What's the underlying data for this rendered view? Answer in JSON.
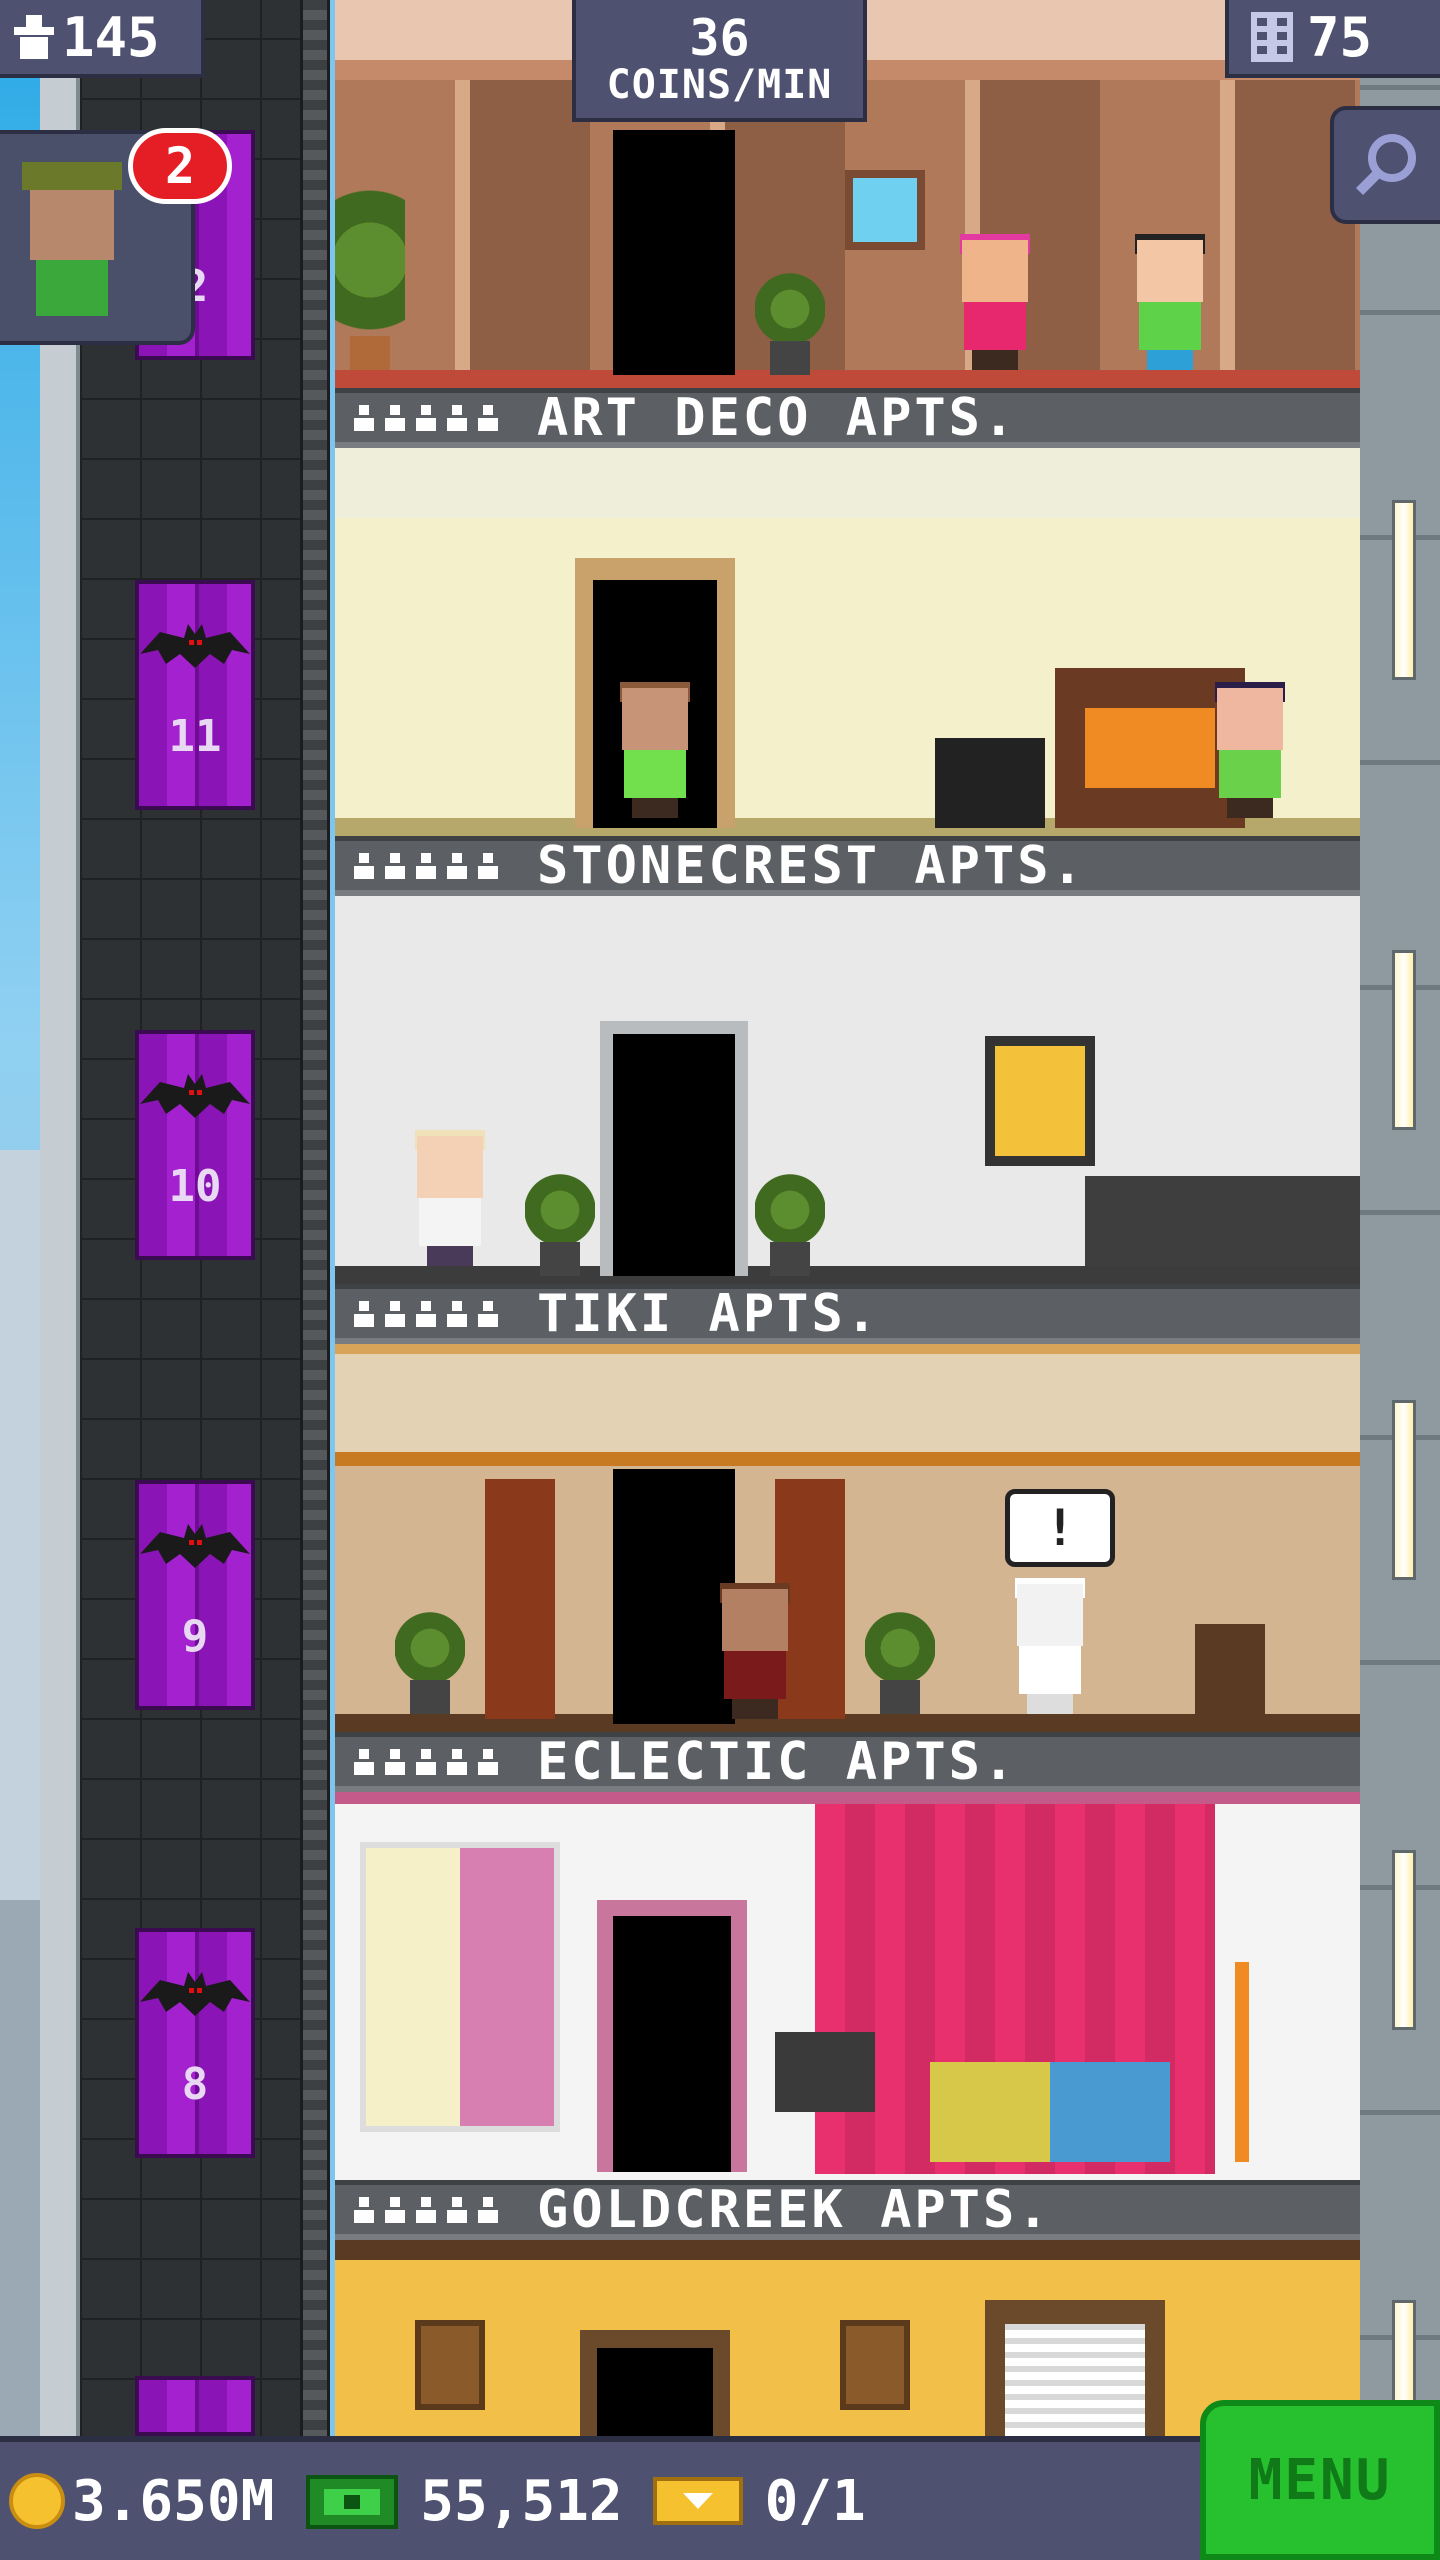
{
  "hud": {
    "population": "145",
    "coins_rate_value": "36",
    "coins_rate_unit": "COINS/MIN",
    "floors": "75",
    "notification_count": "2",
    "search_icon": "magnifier-icon"
  },
  "elevator": {
    "floors": [
      "2",
      "11",
      "10",
      "9",
      "8"
    ]
  },
  "floors": [
    {
      "name": "ART DECO APTS.",
      "residents": 5
    },
    {
      "name": "STONECREST APTS.",
      "residents": 5
    },
    {
      "name": "TIKI APTS.",
      "residents": 5
    },
    {
      "name": "ECLECTIC APTS.",
      "residents": 5
    },
    {
      "name": "GOLDCREEK APTS.",
      "residents": 5
    }
  ],
  "speech_bubble": "!",
  "bottom_bar": {
    "coins": "3.650M",
    "bux": "55,512",
    "tickets": "0/1",
    "menu_label": "MENU"
  },
  "colors": {
    "hud_bg": "#4e5170",
    "elevator_door": "#8b14b6",
    "menu_green": "#27c130",
    "badge_red": "#e51e25"
  }
}
